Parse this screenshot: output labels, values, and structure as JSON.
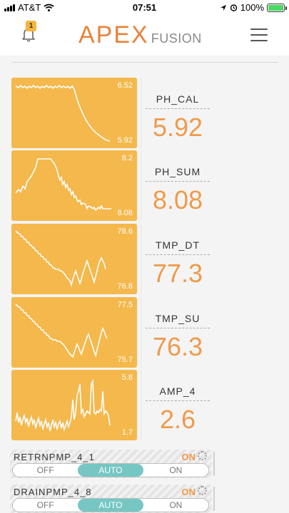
{
  "status_bar": {
    "carrier": "AT&T",
    "time": "07:51",
    "battery": "100%",
    "battery_level": 1.0
  },
  "header": {
    "notification_count": "1",
    "logo_main": "APEX",
    "logo_sub": "FUSION"
  },
  "colors": {
    "accent": "#ef9a4a",
    "tile": "#f4b84c",
    "auto_active": "#76c7c4"
  },
  "tiles": [
    {
      "name": "PH_CAL",
      "value": "5.92",
      "max": "6.52",
      "min": "5.92"
    },
    {
      "name": "PH_SUM",
      "value": "8.08",
      "max": "8.2",
      "min": "8.08"
    },
    {
      "name": "TMP_DT",
      "value": "77.3",
      "max": "78.6",
      "min": "76.8"
    },
    {
      "name": "TMP_SU",
      "value": "76.3",
      "max": "77.5",
      "min": "75.7"
    },
    {
      "name": "AMP_4",
      "value": "2.6",
      "max": "5.8",
      "min": "1.7"
    }
  ],
  "outlets": [
    {
      "name": "RETRNPMP_4_1",
      "state": "ON",
      "options": [
        "OFF",
        "AUTO",
        "ON"
      ],
      "selected": "AUTO"
    },
    {
      "name": "DRAINPMP_4_8",
      "state": "ON",
      "options": [
        "OFF",
        "AUTO",
        "ON"
      ],
      "selected": "AUTO"
    }
  ]
}
